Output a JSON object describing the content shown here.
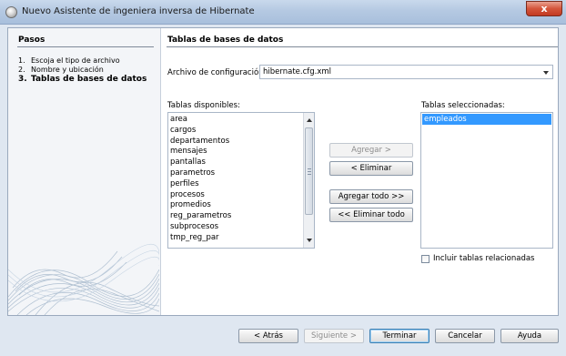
{
  "window": {
    "title": "Nuevo  Asistente de ingeniera inversa de Hibernate",
    "close_label": "x"
  },
  "steps": {
    "title": "Pasos",
    "items": [
      {
        "num": "1.",
        "label": "Escoja el tipo de archivo"
      },
      {
        "num": "2.",
        "label": "Nombre y ubicación"
      },
      {
        "num": "3.",
        "label": "Tablas de bases de datos"
      }
    ]
  },
  "main": {
    "title": "Tablas de bases de datos",
    "config_label": "Archivo de configuración:",
    "config_value": "hibernate.cfg.xml",
    "available_label": "Tablas disponibles:",
    "available_tables": [
      "area",
      "cargos",
      "departamentos",
      "mensajes",
      "pantallas",
      "parametros",
      "perfiles",
      "procesos",
      "promedios",
      "reg_parametros",
      "subprocesos",
      "tmp_reg_par"
    ],
    "selected_label": "Tablas seleccionadas:",
    "selected_tables": [
      "empleados"
    ],
    "buttons": {
      "add": "Agregar >",
      "remove": "< Eliminar",
      "add_all": "Agregar todo >>",
      "remove_all": "<< Eliminar todo"
    },
    "include_related_label": "Incluir tablas relacionadas",
    "include_related_checked": false
  },
  "footer": {
    "back": "< Atrás",
    "next": "Siguiente >",
    "finish": "Terminar",
    "cancel": "Cancelar",
    "help": "Ayuda"
  },
  "colors": {
    "selection": "#3399ff",
    "title_bar": "#b5c9e2",
    "close": "#c23a22"
  }
}
